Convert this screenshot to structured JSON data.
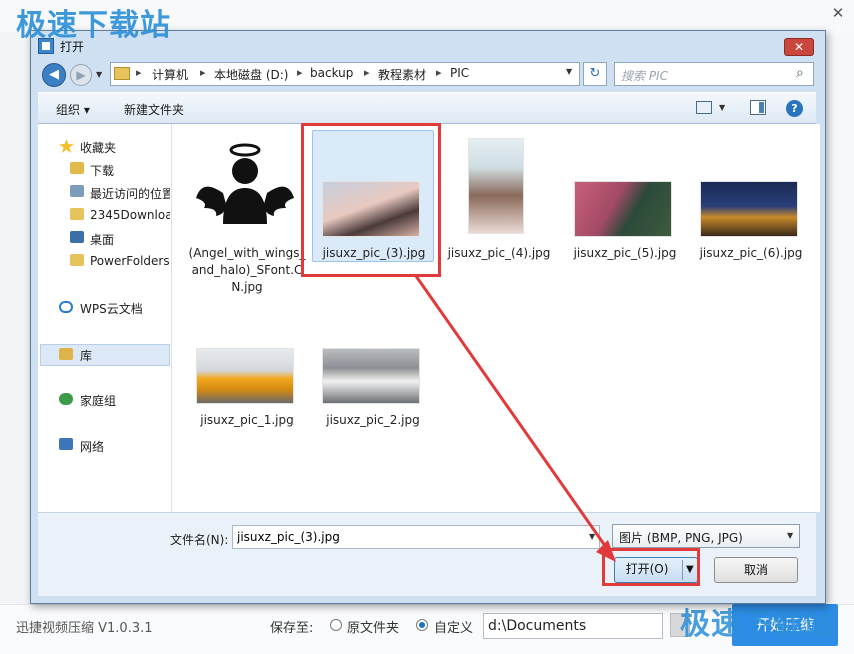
{
  "app": {
    "watermark": "极速下载站",
    "close_glyph": "✕",
    "version": "迅捷视频压缩 V1.0.3.1",
    "save_to_label": "保存至:",
    "option_original": "原文件夹",
    "option_custom": "自定义",
    "save_path": "d:\\Documents",
    "start_label": "开始压缩"
  },
  "dialog": {
    "title": "打开",
    "close_glyph": "✕",
    "back_glyph": "◀",
    "fwd_glyph": "▶",
    "dropdown_glyph": "▼",
    "address": [
      "计算机",
      "本地磁盘 (D:)",
      "backup",
      "教程素材",
      "PIC"
    ],
    "crumb_sep": "▸",
    "refresh_glyph": "↻",
    "search_placeholder": "搜索 PIC",
    "search_glyph": "⌕",
    "toolbar": {
      "organize": "组织 ▾",
      "new_folder": "新建文件夹",
      "help_glyph": "?"
    },
    "nav": {
      "favorites": "收藏夹",
      "downloads": "下载",
      "recent": "最近访问的位置",
      "folder_2345": "2345Downloads",
      "desktop": "桌面",
      "powerfolders": "PowerFolders",
      "wps_cloud": "WPS云文档",
      "library": "库",
      "homegroup": "家庭组",
      "network": "网络"
    },
    "files": [
      {
        "name": "(Angel_with_wings_and_halo)_SFont.CN.jpg",
        "lines": [
          "(Angel_with_wings_",
          "and_halo)_SFont.C",
          "N.jpg"
        ]
      },
      {
        "name": "jisuxz_pic_(3).jpg",
        "selected": true
      },
      {
        "name": "jisuxz_pic_(4).jpg"
      },
      {
        "name": "jisuxz_pic_(5).jpg"
      },
      {
        "name": "jisuxz_pic_(6).jpg"
      },
      {
        "name": "jisuxz_pic_1.jpg"
      },
      {
        "name": "jisuxz_pic_2.jpg"
      }
    ],
    "filename_label": "文件名(N):",
    "filename_value": "jisuxz_pic_(3).jpg",
    "filetype": "图片 (BMP, PNG, JPG)",
    "open_label": "打开(O)",
    "open_dd_glyph": "▼",
    "cancel_label": "取消"
  },
  "colors": {
    "accent": "#2d8ce6",
    "highlight": "#e03a3a",
    "selection": "#dbeaf9"
  }
}
